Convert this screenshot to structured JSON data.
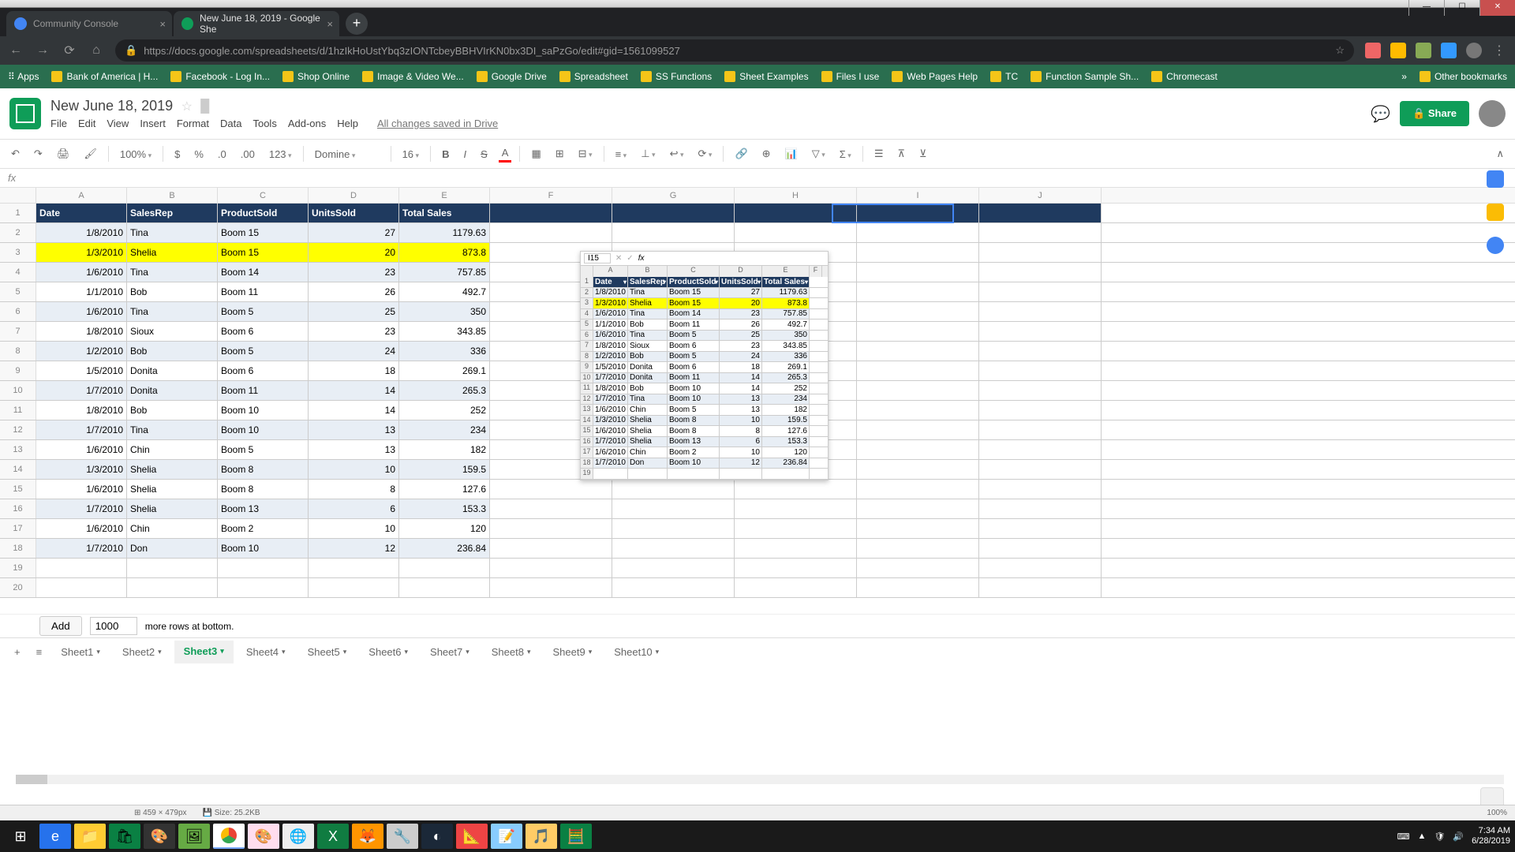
{
  "window": {
    "min": "—",
    "max": "☐",
    "close": "✕"
  },
  "tabs": [
    {
      "title": "Community Console",
      "fav": "#4285f4"
    },
    {
      "title": "New June 18, 2019 - Google She",
      "fav": "#0f9d58"
    }
  ],
  "newtab": "+",
  "nav": {
    "back": "←",
    "fwd": "→",
    "reload": "⟳",
    "home": "⌂"
  },
  "addr": {
    "lock": "🔒",
    "url": "https://docs.google.com/spreadsheets/d/1hzIkHoUstYbq3zIONTcbeyBBHVIrKN0bx3DI_saPzGo/edit#gid=1561099527",
    "star": "☆"
  },
  "ext_count": 6,
  "bookmarks": [
    "Apps",
    "Bank of America | H...",
    "Facebook - Log In...",
    "Shop Online",
    "Image & Video We...",
    "Google Drive",
    "Spreadsheet",
    "SS Functions",
    "Sheet Examples",
    "Files I use",
    "Web Pages Help",
    "TC",
    "Function Sample Sh...",
    "Chromecast"
  ],
  "bm_more": "»",
  "bm_other": "Other bookmarks",
  "doc": {
    "title": "New June 18, 2019",
    "star": "☆"
  },
  "menus": [
    "File",
    "Edit",
    "View",
    "Insert",
    "Format",
    "Data",
    "Tools",
    "Add-ons",
    "Help"
  ],
  "saved": "All changes saved in Drive",
  "comments_icon": "💬",
  "share": "Share",
  "toolbar": {
    "undo": "↶",
    "redo": "↷",
    "print": "🖨",
    "paint": "🖌",
    "zoom": "100%",
    "dollar": "$",
    "pct": "%",
    "dec0": ".0",
    "dec00": ".00",
    "more": "123",
    "font": "Domine",
    "size": "16",
    "bold": "B",
    "italic": "I",
    "strike": "S",
    "color": "A",
    "fill": "▦",
    "borders": "⊞",
    "merge": "⊟",
    "halign": "≡",
    "valign": "⊥",
    "wrap": "↩",
    "rotate": "⟳",
    "link": "🔗",
    "comment": "⊕",
    "chart": "📊",
    "filter": "▽",
    "sigma": "Σ",
    "extra1": "☰",
    "extra2": "⊼",
    "extra3": "⊻",
    "collapse": "∧"
  },
  "fx_label": "fx",
  "columns": [
    "A",
    "B",
    "C",
    "D",
    "E",
    "F",
    "G",
    "H",
    "I",
    "J"
  ],
  "headers": [
    "Date",
    "SalesRep",
    "ProductSold",
    "UnitsSold",
    "Total Sales"
  ],
  "rows": [
    {
      "d": "1/8/2010",
      "r": "Tina",
      "p": "Boom 15",
      "u": "27",
      "t": "1179.63",
      "hl": false,
      "alt": true
    },
    {
      "d": "1/3/2010",
      "r": "Shelia",
      "p": "Boom 15",
      "u": "20",
      "t": "873.8",
      "hl": true,
      "alt": false
    },
    {
      "d": "1/6/2010",
      "r": "Tina",
      "p": "Boom 14",
      "u": "23",
      "t": "757.85",
      "hl": false,
      "alt": true
    },
    {
      "d": "1/1/2010",
      "r": "Bob",
      "p": "Boom 11",
      "u": "26",
      "t": "492.7",
      "hl": false,
      "alt": false
    },
    {
      "d": "1/6/2010",
      "r": "Tina",
      "p": "Boom 5",
      "u": "25",
      "t": "350",
      "hl": false,
      "alt": true
    },
    {
      "d": "1/8/2010",
      "r": "Sioux",
      "p": "Boom 6",
      "u": "23",
      "t": "343.85",
      "hl": false,
      "alt": false
    },
    {
      "d": "1/2/2010",
      "r": "Bob",
      "p": "Boom 5",
      "u": "24",
      "t": "336",
      "hl": false,
      "alt": true
    },
    {
      "d": "1/5/2010",
      "r": "Donita",
      "p": "Boom 6",
      "u": "18",
      "t": "269.1",
      "hl": false,
      "alt": false
    },
    {
      "d": "1/7/2010",
      "r": "Donita",
      "p": "Boom 11",
      "u": "14",
      "t": "265.3",
      "hl": false,
      "alt": true
    },
    {
      "d": "1/8/2010",
      "r": "Bob",
      "p": "Boom 10",
      "u": "14",
      "t": "252",
      "hl": false,
      "alt": false
    },
    {
      "d": "1/7/2010",
      "r": "Tina",
      "p": "Boom 10",
      "u": "13",
      "t": "234",
      "hl": false,
      "alt": true
    },
    {
      "d": "1/6/2010",
      "r": "Chin",
      "p": "Boom 5",
      "u": "13",
      "t": "182",
      "hl": false,
      "alt": false
    },
    {
      "d": "1/3/2010",
      "r": "Shelia",
      "p": "Boom 8",
      "u": "10",
      "t": "159.5",
      "hl": false,
      "alt": true
    },
    {
      "d": "1/6/2010",
      "r": "Shelia",
      "p": "Boom 8",
      "u": "8",
      "t": "127.6",
      "hl": false,
      "alt": false
    },
    {
      "d": "1/7/2010",
      "r": "Shelia",
      "p": "Boom 13",
      "u": "6",
      "t": "153.3",
      "hl": false,
      "alt": true
    },
    {
      "d": "1/6/2010",
      "r": "Chin",
      "p": "Boom 2",
      "u": "10",
      "t": "120",
      "hl": false,
      "alt": false
    },
    {
      "d": "1/7/2010",
      "r": "Don",
      "p": "Boom 10",
      "u": "12",
      "t": "236.84",
      "hl": false,
      "alt": true
    }
  ],
  "empty_rows": [
    19,
    20
  ],
  "mini": {
    "namebox": "I15",
    "fx": "fx",
    "cols": [
      "A",
      "B",
      "C",
      "D",
      "E",
      "F"
    ],
    "extra_rows": [
      19
    ]
  },
  "add": {
    "btn": "Add",
    "val": "1000",
    "text": "more rows at bottom."
  },
  "sheets": [
    "Sheet1",
    "Sheet2",
    "Sheet3",
    "Sheet4",
    "Sheet5",
    "Sheet6",
    "Sheet7",
    "Sheet8",
    "Sheet9",
    "Sheet10"
  ],
  "active_sheet": "Sheet3",
  "plus": "+",
  "all_sheets": "≡",
  "status": {
    "dim": "459 × 479px",
    "size": "Size: 25.2KB",
    "zoom": "100%"
  },
  "tray": {
    "time": "7:34 AM",
    "date": "6/28/2019"
  }
}
